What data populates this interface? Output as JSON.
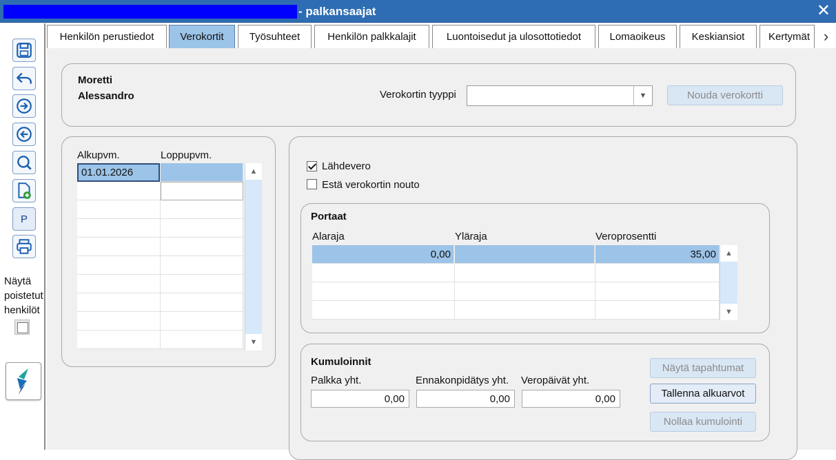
{
  "window": {
    "title": "- palkansaajat"
  },
  "toolbar": {
    "p_label": "P",
    "show_deleted_label": "Näytä poistetut henkilöt"
  },
  "tabs": [
    {
      "label": "Henkilön perustiedot"
    },
    {
      "label": "Verokortit"
    },
    {
      "label": "Työsuhteet"
    },
    {
      "label": "Henkilön palkkalajit"
    },
    {
      "label": "Luontoisedut ja ulosottotiedot"
    },
    {
      "label": "Lomaoikeus"
    },
    {
      "label": "Keskiansiot"
    },
    {
      "label": "Kertymät"
    }
  ],
  "person": {
    "last_name": "Moretti",
    "first_name": "Alessandro"
  },
  "card_type": {
    "label": "Verokortin tyyppi",
    "value": "",
    "fetch_button": "Nouda verokortti"
  },
  "periods": {
    "headers": [
      "Alkupvm.",
      "Loppupvm."
    ],
    "rows": [
      {
        "start": "01.01.2026",
        "end": ""
      }
    ]
  },
  "options": {
    "withholding_label": "Lähdevero",
    "withholding_checked": true,
    "prevent_fetch_label": "Estä verokortin nouto",
    "prevent_fetch_checked": false
  },
  "brackets": {
    "title": "Portaat",
    "headers": [
      "Alaraja",
      "Yläraja",
      "Veroprosentti"
    ],
    "rows": [
      {
        "lower": "0,00",
        "upper": "",
        "percent": "35,00"
      }
    ]
  },
  "cumulative": {
    "title": "Kumuloinnit",
    "salary_label": "Palkka yht.",
    "withholding_label": "Ennakonpidätys yht.",
    "taxdays_label": "Veropäivät yht.",
    "salary": "0,00",
    "withholding": "0,00",
    "taxdays": "0,00",
    "show_events_button": "Näytä tapahtumat",
    "save_initial_button": "Tallenna alkuarvot",
    "reset_button": "Nollaa kumulointi"
  },
  "colors": {
    "titlebar": "#2e6db3",
    "selected": "#9cc3e8",
    "accent": "#1a5fb0"
  }
}
